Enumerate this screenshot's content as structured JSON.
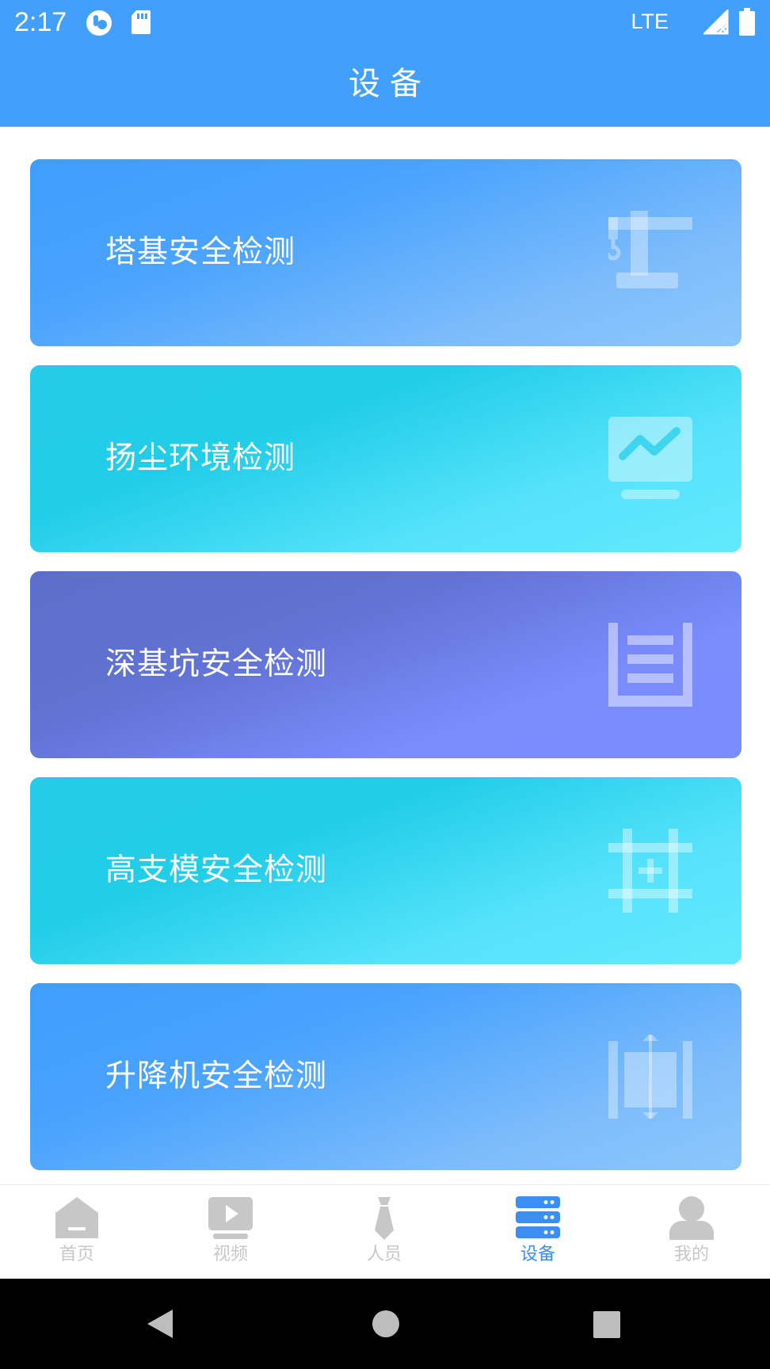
{
  "status_bar": {
    "time": "2:17",
    "network": "LTE",
    "icons": [
      "launcher-icon",
      "sd-card-icon",
      "signal-icon",
      "battery-icon"
    ]
  },
  "app_bar": {
    "title": "设备"
  },
  "cards": [
    {
      "label": "塔基安全检测",
      "icon": "tower-crane-icon",
      "color": "blue"
    },
    {
      "label": "扬尘环境检测",
      "icon": "monitor-chart-icon",
      "color": "cyan"
    },
    {
      "label": "深基坑安全检测",
      "icon": "foundation-pit-icon",
      "color": "purple"
    },
    {
      "label": "高支模安全检测",
      "icon": "formwork-grid-icon",
      "color": "cyan"
    },
    {
      "label": "升降机安全检测",
      "icon": "elevator-icon",
      "color": "blue"
    }
  ],
  "bottom_nav": {
    "items": [
      {
        "label": "首页",
        "icon": "home-icon",
        "active": false
      },
      {
        "label": "视频",
        "icon": "video-icon",
        "active": false
      },
      {
        "label": "人员",
        "icon": "tie-icon",
        "active": false
      },
      {
        "label": "设备",
        "icon": "server-icon",
        "active": true
      },
      {
        "label": "我的",
        "icon": "user-icon",
        "active": false
      }
    ],
    "active_color": "#3a8ff3",
    "inactive_color": "#c7c7c7"
  },
  "colors": {
    "primary": "#42a0fc",
    "card_blue": "#4aa3fd",
    "card_cyan": "#22cde8",
    "card_purple": "#6072d3"
  }
}
